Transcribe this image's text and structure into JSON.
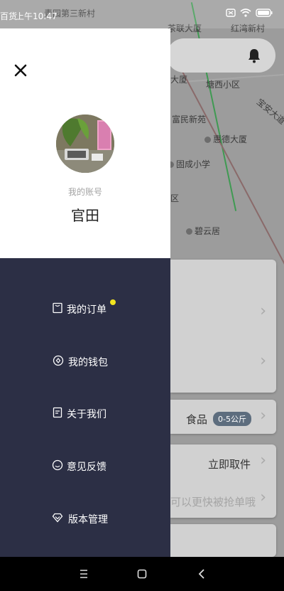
{
  "status_bar": {
    "time": "上午10:47",
    "left_fragment": "百货"
  },
  "map": {
    "labels": [
      {
        "text": "青园第三新村",
        "poi": false
      },
      {
        "text": "茶联大厦",
        "poi": false
      },
      {
        "text": "红湾新村",
        "poi": false
      },
      {
        "text": "大厦",
        "poi": false
      },
      {
        "text": "塘西小区",
        "poi": false
      },
      {
        "text": "富民新苑",
        "poi": false
      },
      {
        "text": "惠德大厦",
        "poi": true
      },
      {
        "text": "固成小学",
        "poi": true
      },
      {
        "text": "碧云居",
        "poi": true
      },
      {
        "text": "宝安大道",
        "poi": false
      },
      {
        "text": "区",
        "poi": false
      }
    ]
  },
  "drawer": {
    "account_label": "我的账号",
    "account_name": "官田",
    "menu": [
      {
        "label": "我的订单",
        "icon": "order-icon"
      },
      {
        "label": "我的钱包",
        "icon": "wallet-icon"
      },
      {
        "label": "关于我们",
        "icon": "about-icon"
      },
      {
        "label": "意见反馈",
        "icon": "feedback-icon"
      },
      {
        "label": "版本管理",
        "icon": "version-icon"
      }
    ]
  },
  "cards": {
    "food_label": "食品",
    "food_badge": "0-5公斤",
    "pickup_label": "立即取件",
    "hint_text": "可以更快被抢单哦"
  },
  "colors": {
    "drawer_menu_bg": "#2c2f45",
    "notification_dot": "#f2e51f",
    "badge_bg": "#5d6d7e"
  }
}
